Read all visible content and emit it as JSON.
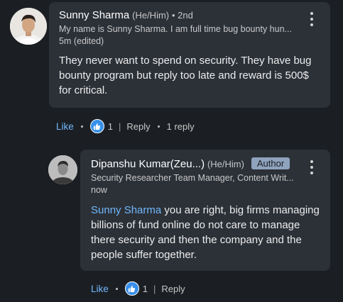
{
  "comment": {
    "author": "Sunny Sharma",
    "pronouns": "(He/Him)",
    "degree": "• 2nd",
    "headline": "My name is Sunny Sharma. I am full time bug bounty hun...",
    "time": "5m (edited)",
    "text": "They never want to spend on security. They have bug bounty program but reply too late and reward is 500$ for critical.",
    "actions": {
      "like": "Like",
      "reaction_count": "1",
      "reply": "Reply",
      "replies": "1 reply"
    }
  },
  "reply": {
    "author": "Dipanshu Kumar(Zeu...)",
    "pronouns": "(He/Him)",
    "badge": "Author",
    "headline": "Security Researcher Team Manager, Content Writ...",
    "time": "now",
    "mention": "Sunny Sharma",
    "text": " you are right, big firms managing billions of fund online do not care to manage there security and then the company and the people suffer together.",
    "actions": {
      "like": "Like",
      "reaction_count": "1",
      "reply": "Reply"
    }
  },
  "colors": {
    "background": "#1b1f23",
    "bubble": "#2c3138",
    "link": "#71b7fb",
    "reaction": "#378fe9",
    "badge": "#8fa3bd"
  },
  "icons": [
    "more-options-icon",
    "thumbs-up-reaction-icon"
  ]
}
